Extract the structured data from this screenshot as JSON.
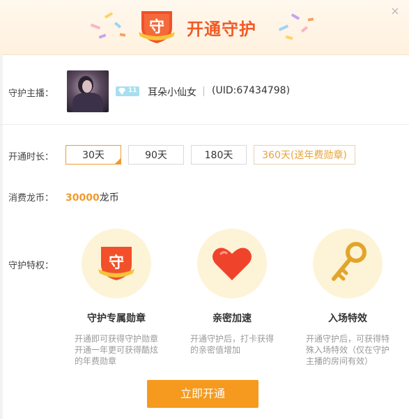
{
  "colors": {
    "accent_orange": "#f25a26",
    "button_orange": "#f59a1f",
    "selected_border": "#f29a2e",
    "highlight_gold": "#e8a23a",
    "privilege_bg": "#fdf3d6"
  },
  "header": {
    "title": "开通守护",
    "logo_char": "守",
    "close_icon": "close-icon"
  },
  "anchor": {
    "label": "守护主播：",
    "level": "11",
    "name": "耳朵小仙女",
    "uid": "(UID:67434798)"
  },
  "duration": {
    "label": "开通时长：",
    "options": [
      "30天",
      "90天",
      "180天",
      "360天(送年费勋章)"
    ],
    "selected": "30天"
  },
  "cost": {
    "label": "消费龙币：",
    "amount": "30000",
    "unit": "龙币"
  },
  "privileges": {
    "label": "守护特权：",
    "items": [
      {
        "icon": "shield-badge-icon",
        "icon_char": "守",
        "title": "守护专属勋章",
        "desc": "开通即可获得守护勋章开通一年更可获得酷炫的年费勋章"
      },
      {
        "icon": "heart-icon",
        "title": "亲密加速",
        "desc": "开通守护后，打卡获得的亲密值增加"
      },
      {
        "icon": "key-icon",
        "title": "入场特效",
        "desc": "开通守护后，可获得特殊入场特效（仅在守护主播的房间有效）"
      }
    ]
  },
  "action": {
    "open_label": "立即开通"
  }
}
